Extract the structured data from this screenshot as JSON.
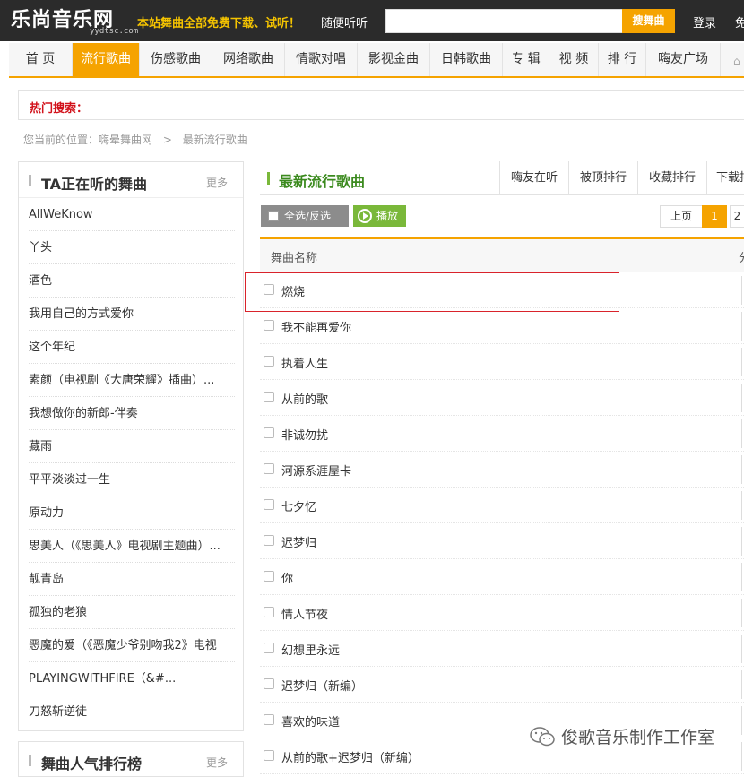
{
  "header": {
    "logo": "乐尚音乐网",
    "logo_domain": "yydtsc.com",
    "slogan": "本站舞曲全部免费下载、试听！",
    "listen_link": "随便听听",
    "search_value": "",
    "search_button": "搜舞曲",
    "login": "登录",
    "free_partial": "免"
  },
  "nav": {
    "items": [
      "首 页",
      "流行歌曲",
      "伤感歌曲",
      "网络歌曲",
      "情歌对唱",
      "影视金曲",
      "日韩歌曲",
      "专 辑",
      "视 频",
      "排 行",
      "嗨友广场"
    ],
    "active_index": 1
  },
  "hot_search": {
    "label": "热门搜索："
  },
  "breadcrumb": {
    "prefix": "您当前的位置：嗨晕舞曲网",
    "separator": ">",
    "current": "最新流行歌曲"
  },
  "sidebar": {
    "title": "TA正在听的舞曲",
    "more": "更多",
    "items": [
      "AllWeKnow",
      "丫头",
      "酒色",
      "我用自己的方式爱你",
      "这个年纪",
      "素颜（电视剧《大唐荣耀》插曲）...",
      "我想做你的新郎-伴奏",
      "藏雨",
      "平平淡淡过一生",
      "原动力",
      "思美人（《思美人》电视剧主题曲）...",
      "靓青岛",
      "孤独的老狼",
      "恶魔的爱（《恶魔少爷别吻我2》电视",
      "PLAYINGWITHFIRE（&#...",
      "刀怒斩逆徒"
    ],
    "second_title": "舞曲人气排行榜",
    "second_more": "更多"
  },
  "main": {
    "title": "最新流行歌曲",
    "tabs": [
      "嗨友在听",
      "被顶排行",
      "收藏排行",
      "下载排"
    ],
    "select_all": "全选/反选",
    "play": "播放",
    "pager": {
      "prev": "上页",
      "current": "1",
      "next_partial": "2"
    },
    "column_name": "舞曲名称",
    "column_right_partial": "分",
    "songs": [
      "燃烧",
      "我不能再爱你",
      "执着人生",
      "从前的歌",
      "非诚勿扰",
      "河源系涯屋卡",
      "七夕忆",
      "迟梦归",
      "你",
      "情人节夜",
      "幻想里永远",
      "迟梦归（新编）",
      "喜欢的味道",
      "从前的歌+迟梦归（新编）"
    ]
  },
  "watermark": {
    "text": "俊歌音乐制作工作室",
    "icon": "wechat-icon"
  },
  "colors": {
    "accent": "#f5a300",
    "green": "#7ab83a",
    "hot_red": "#d2121b",
    "highlight_red": "#d9232b",
    "topbar": "#2b2b2b"
  }
}
